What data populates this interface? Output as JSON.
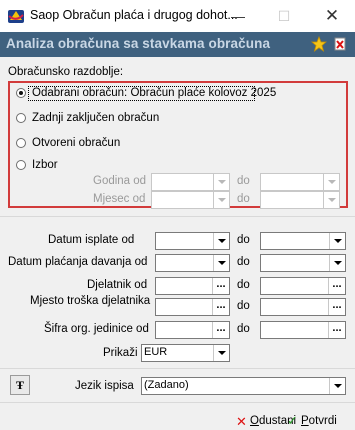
{
  "window": {
    "title": "Saop Obračun plaća i drugog dohot...",
    "min_glyph": "—",
    "max_glyph": "☐",
    "close_glyph": "✕"
  },
  "header": {
    "title": "Analiza obračuna sa stavkama obračuna",
    "icons": [
      "star-icon",
      "delete-document-icon"
    ]
  },
  "period": {
    "label": "Obračunsko razdoblje:",
    "options": [
      {
        "label": "Odabrani obračun: Obračun plaće kolovoz 2025",
        "selected": true
      },
      {
        "label": "Zadnji zaključen obračun",
        "selected": false
      },
      {
        "label": "Otvoreni obračun",
        "selected": false
      },
      {
        "label": "Izbor",
        "selected": false
      }
    ],
    "year_from_label": "Godina od",
    "month_from_label": "Mjesec od",
    "to_label": "do"
  },
  "filters": {
    "payout_date_label": "Datum isplate od",
    "contribution_date_label": "Datum plaćanja davanja od",
    "employee_label": "Djelatnik od",
    "cost_center_label": "Mjesto troška djelatnika",
    "org_unit_label": "Šifra org. jedinice od",
    "to_label": "do",
    "lookup_glyph": "..."
  },
  "display": {
    "label": "Prikaži",
    "currency": "EUR"
  },
  "print": {
    "language_label": "Jezik ispisa",
    "language_value": "(Zadano)"
  },
  "footer": {
    "cancel_u": "O",
    "cancel_rest": "dustani",
    "confirm_u": "P",
    "confirm_rest": "otvrdi"
  },
  "colors": {
    "header_bg": "#3f617f",
    "header_text": "#c9d7e5",
    "highlight_border": "#d23b3b",
    "cancel": "#dd1111",
    "confirm": "#2a9d2a"
  }
}
